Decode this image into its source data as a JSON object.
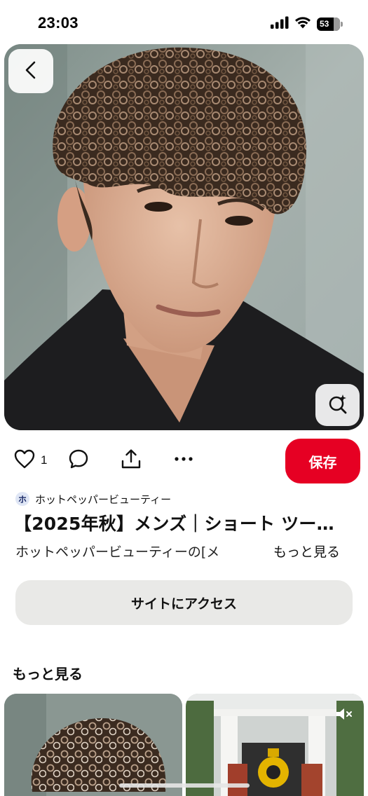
{
  "status_bar": {
    "time": "23:03",
    "battery": "53",
    "icons": [
      "cellular-signal-icon",
      "wifi-icon",
      "battery-icon"
    ]
  },
  "navigation": {
    "back_icon": "chevron-left-icon"
  },
  "hero": {
    "visual_search_icon": "lens-sparkle-icon"
  },
  "actions": {
    "like_count": "1",
    "save_label": "保存",
    "icons": [
      "heart-icon",
      "comment-icon",
      "share-icon",
      "more-options-icon"
    ]
  },
  "pin": {
    "source_avatar": "ホ",
    "source_name": "ホットペッパービューティー",
    "title": "【2025年秋】メンズ｜ショート ツー…",
    "description": "ホットペッパービューティーの[メ",
    "more_label": "もっと見る"
  },
  "visit_button_label": "サイトにアクセス",
  "more_section": {
    "heading": "もっと見る"
  },
  "colors": {
    "save_button": "#e60023",
    "visit_button": "#e9e9e7",
    "text": "#111111"
  }
}
